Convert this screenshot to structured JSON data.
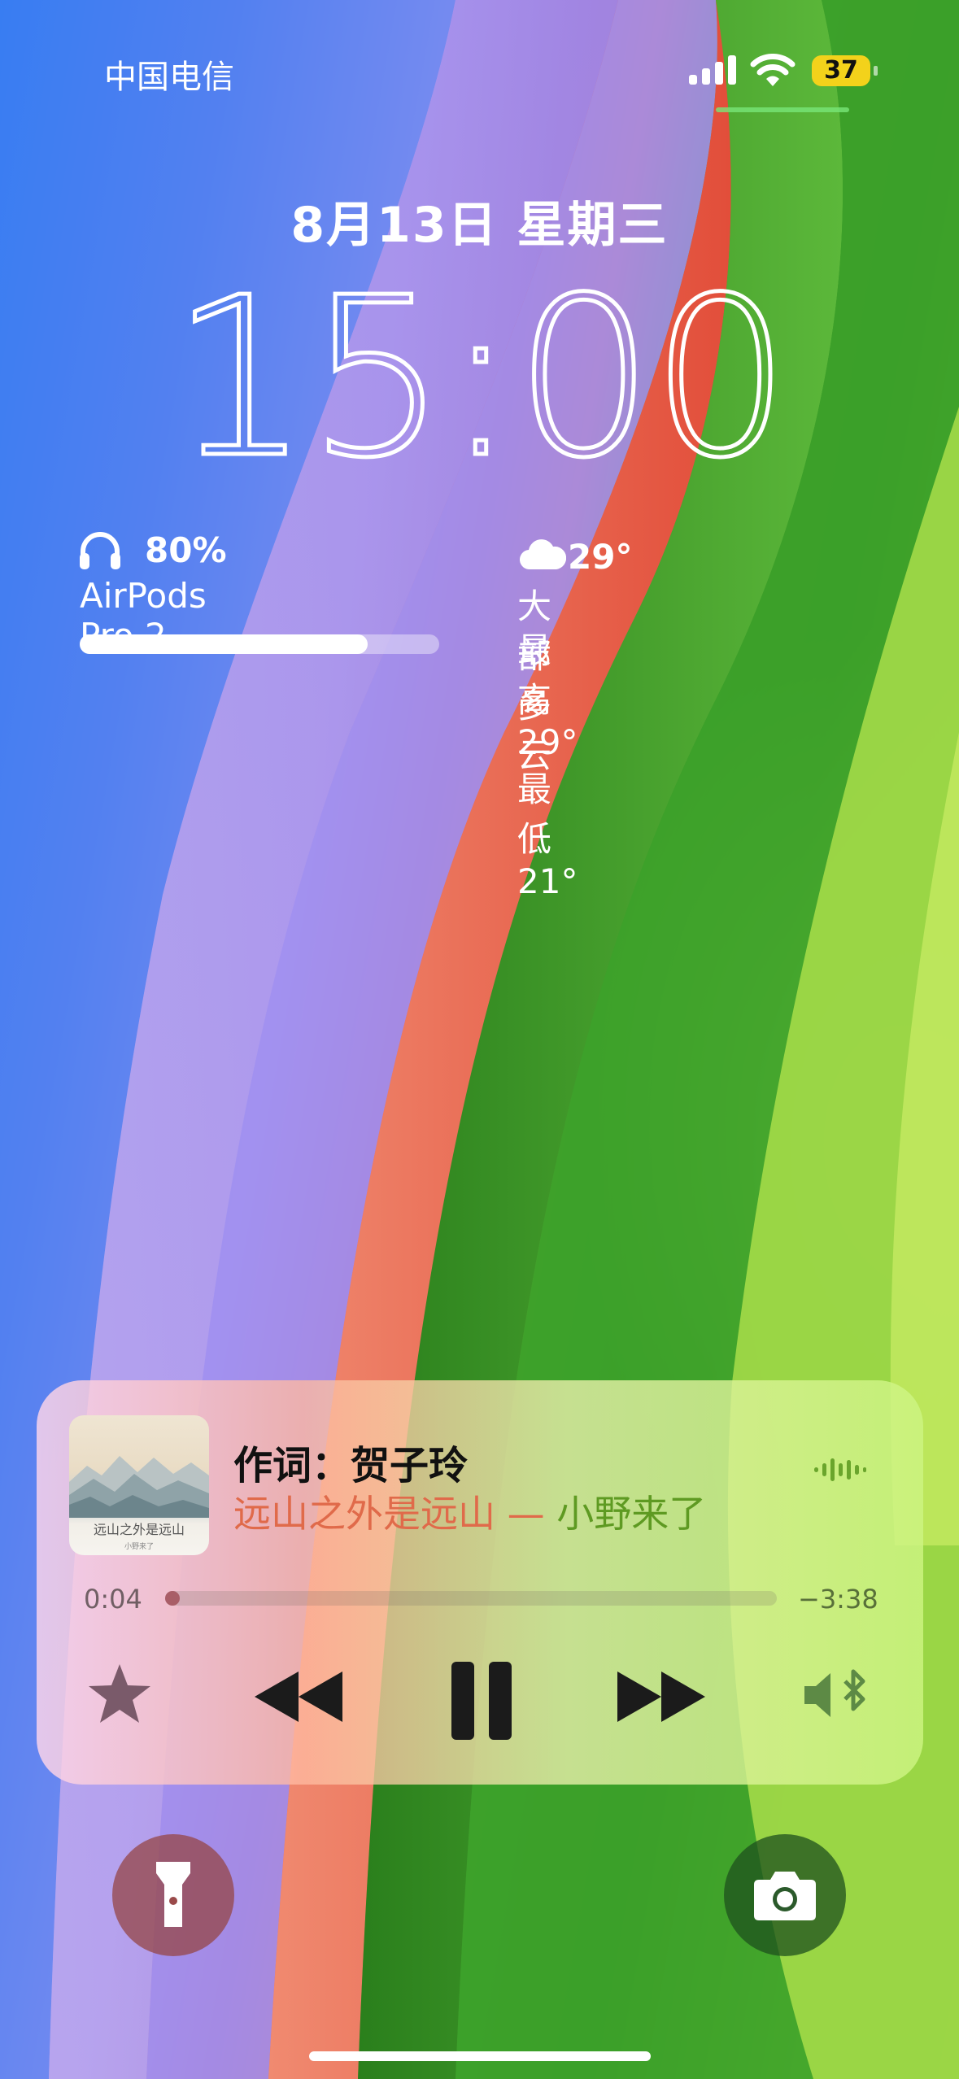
{
  "status_bar": {
    "carrier": "中国电信",
    "battery_level": "37",
    "battery_color": "#f3d21b"
  },
  "lock_screen": {
    "date": "8月13日 星期三",
    "time": "15:00"
  },
  "widgets": {
    "airpods": {
      "icon": "headphones-icon",
      "percent": "80%",
      "name": "AirPods Pro 2",
      "level": 0.8
    },
    "weather": {
      "icon": "cloud-icon",
      "temperature": "29°",
      "condition": "大部多云",
      "range": "最高 29° 最低 21°"
    }
  },
  "now_playing": {
    "title": "作词：贺子玲",
    "song": "远山之外是远山",
    "separator": " — ",
    "artist": "小野来了",
    "elapsed": "0:04",
    "remaining": "−3:38",
    "progress": 0.018,
    "song_color": "#e06a4a",
    "artist_color": "#5e9a22",
    "artwork_caption": "远山之外是远山",
    "artwork_sub": "小野来了",
    "controls": {
      "favorite": "star-icon",
      "previous": "rewind-icon",
      "play_pause": "pause-icon",
      "next": "fast-forward-icon",
      "output": "bluetooth-speaker-icon"
    }
  },
  "quick_actions": {
    "left": "flashlight-icon",
    "right": "camera-icon"
  }
}
